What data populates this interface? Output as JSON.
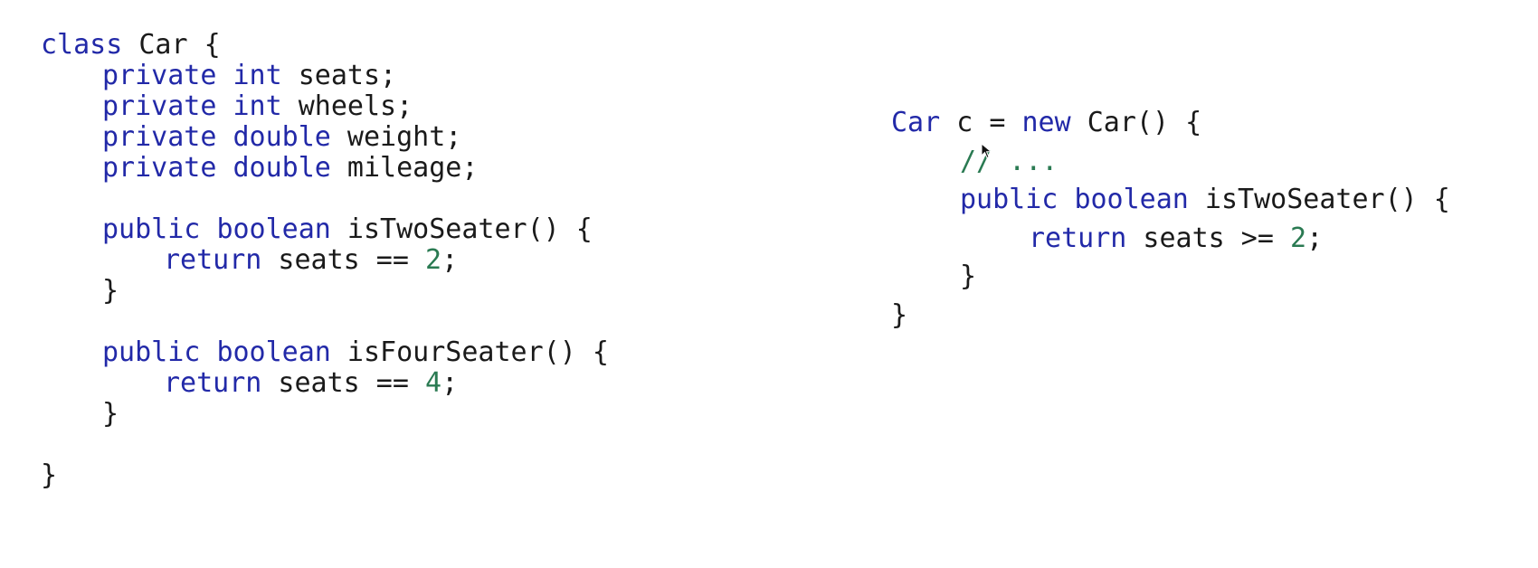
{
  "left_code": {
    "lines": [
      {
        "indent": 0,
        "tokens": [
          {
            "text": "class",
            "kind": "kw"
          },
          {
            "text": " Car {",
            "kind": "id"
          }
        ]
      },
      {
        "indent": 1,
        "tokens": [
          {
            "text": "private",
            "kind": "kw"
          },
          {
            "text": " ",
            "kind": "id"
          },
          {
            "text": "int",
            "kind": "kw"
          },
          {
            "text": " seats;",
            "kind": "id"
          }
        ]
      },
      {
        "indent": 1,
        "tokens": [
          {
            "text": "private",
            "kind": "kw"
          },
          {
            "text": " ",
            "kind": "id"
          },
          {
            "text": "int",
            "kind": "kw"
          },
          {
            "text": " wheels;",
            "kind": "id"
          }
        ]
      },
      {
        "indent": 1,
        "tokens": [
          {
            "text": "private",
            "kind": "kw"
          },
          {
            "text": " ",
            "kind": "id"
          },
          {
            "text": "double",
            "kind": "kw"
          },
          {
            "text": " weight;",
            "kind": "id"
          }
        ]
      },
      {
        "indent": 1,
        "tokens": [
          {
            "text": "private",
            "kind": "kw"
          },
          {
            "text": " ",
            "kind": "id"
          },
          {
            "text": "double",
            "kind": "kw"
          },
          {
            "text": " mileage;",
            "kind": "id"
          }
        ]
      },
      {
        "indent": 0,
        "tokens": []
      },
      {
        "indent": 1,
        "tokens": [
          {
            "text": "public",
            "kind": "kw"
          },
          {
            "text": " ",
            "kind": "id"
          },
          {
            "text": "boolean",
            "kind": "kw"
          },
          {
            "text": " isTwoSeater() {",
            "kind": "id"
          }
        ]
      },
      {
        "indent": 2,
        "tokens": [
          {
            "text": "return",
            "kind": "kw"
          },
          {
            "text": " seats == ",
            "kind": "id"
          },
          {
            "text": "2",
            "kind": "num"
          },
          {
            "text": ";",
            "kind": "id"
          }
        ]
      },
      {
        "indent": 1,
        "tokens": [
          {
            "text": "}",
            "kind": "id"
          }
        ]
      },
      {
        "indent": 0,
        "tokens": []
      },
      {
        "indent": 1,
        "tokens": [
          {
            "text": "public",
            "kind": "kw"
          },
          {
            "text": " ",
            "kind": "id"
          },
          {
            "text": "boolean",
            "kind": "kw"
          },
          {
            "text": " isFourSeater() {",
            "kind": "id"
          }
        ]
      },
      {
        "indent": 2,
        "tokens": [
          {
            "text": "return",
            "kind": "kw"
          },
          {
            "text": " seats == ",
            "kind": "id"
          },
          {
            "text": "4",
            "kind": "num"
          },
          {
            "text": ";",
            "kind": "id"
          }
        ]
      },
      {
        "indent": 1,
        "tokens": [
          {
            "text": "}",
            "kind": "id"
          }
        ]
      },
      {
        "indent": 0,
        "tokens": []
      },
      {
        "indent": 0,
        "tokens": [
          {
            "text": "}",
            "kind": "id"
          }
        ]
      }
    ]
  },
  "right_code": {
    "lines": [
      {
        "indent": 0,
        "tokens": [
          {
            "text": "Car",
            "kind": "kw"
          },
          {
            "text": " c = ",
            "kind": "id"
          },
          {
            "text": "new",
            "kind": "kw"
          },
          {
            "text": " Car() {",
            "kind": "id"
          }
        ]
      },
      {
        "indent": 1,
        "tokens": [
          {
            "text": "// ...",
            "kind": "cm"
          }
        ]
      },
      {
        "indent": 1,
        "tokens": [
          {
            "text": "public",
            "kind": "kw"
          },
          {
            "text": " ",
            "kind": "id"
          },
          {
            "text": "boolean",
            "kind": "kw"
          },
          {
            "text": " isTwoSeater() {",
            "kind": "id"
          }
        ]
      },
      {
        "indent": 2,
        "tokens": [
          {
            "text": "return",
            "kind": "kw"
          },
          {
            "text": " seats >= ",
            "kind": "id"
          },
          {
            "text": "2",
            "kind": "num"
          },
          {
            "text": ";",
            "kind": "id"
          }
        ]
      },
      {
        "indent": 1,
        "tokens": [
          {
            "text": "}",
            "kind": "id"
          }
        ]
      },
      {
        "indent": 0,
        "tokens": [
          {
            "text": "}",
            "kind": "id"
          }
        ]
      }
    ]
  },
  "colors": {
    "keyword": "#2229a8",
    "number": "#2a7a52",
    "comment": "#2a7a52",
    "text": "#1a1a1a",
    "background": "#ffffff"
  },
  "cursor": {
    "icon": "mouse-pointer-icon"
  }
}
